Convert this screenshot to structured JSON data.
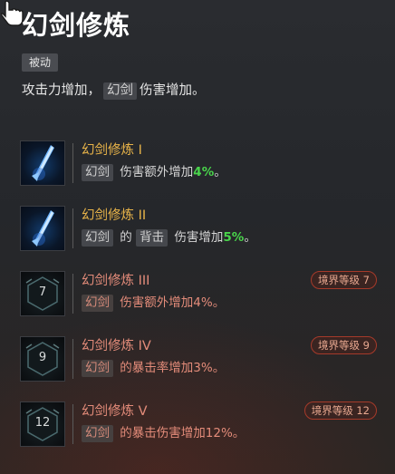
{
  "skill": {
    "title": "幻剑修炼",
    "type_badge": "被动",
    "desc_before": "攻击力增加，",
    "desc_tag": "幻剑",
    "desc_after": "伤害增加。"
  },
  "colors": {
    "unlocked_name": "#e9b449",
    "locked_text": "#e48c7a",
    "value_highlight": "#49d44b",
    "requirement_border": "#a63a2a"
  },
  "tiers": [
    {
      "name": "幻剑修炼 I",
      "state": "unlocked",
      "icon": "crystal-sword-icon",
      "tag": "幻剑",
      "middle": "",
      "text_before": "伤害额外增加",
      "value": "4%",
      "text_after": "。"
    },
    {
      "name": "幻剑修炼 II",
      "state": "unlocked",
      "icon": "crystal-sword-icon",
      "tag": "幻剑",
      "middle": "的",
      "tag2": "背击",
      "text_before": "伤害增加",
      "value": "5%",
      "text_after": "。"
    },
    {
      "name": "幻剑修炼 III",
      "state": "locked",
      "icon": "realm-level-icon",
      "level": "7",
      "requirement": "境界等级 7",
      "tag": "幻剑",
      "text": "伤害额外增加4%。"
    },
    {
      "name": "幻剑修炼 IV",
      "state": "locked",
      "icon": "realm-level-icon",
      "level": "9",
      "requirement": "境界等级 9",
      "tag": "幻剑",
      "text": "的暴击率增加3%。"
    },
    {
      "name": "幻剑修炼 V",
      "state": "locked",
      "icon": "realm-level-icon",
      "level": "12",
      "requirement": "境界等级 12",
      "tag": "幻剑",
      "text": "的暴击伤害增加12%。"
    }
  ]
}
